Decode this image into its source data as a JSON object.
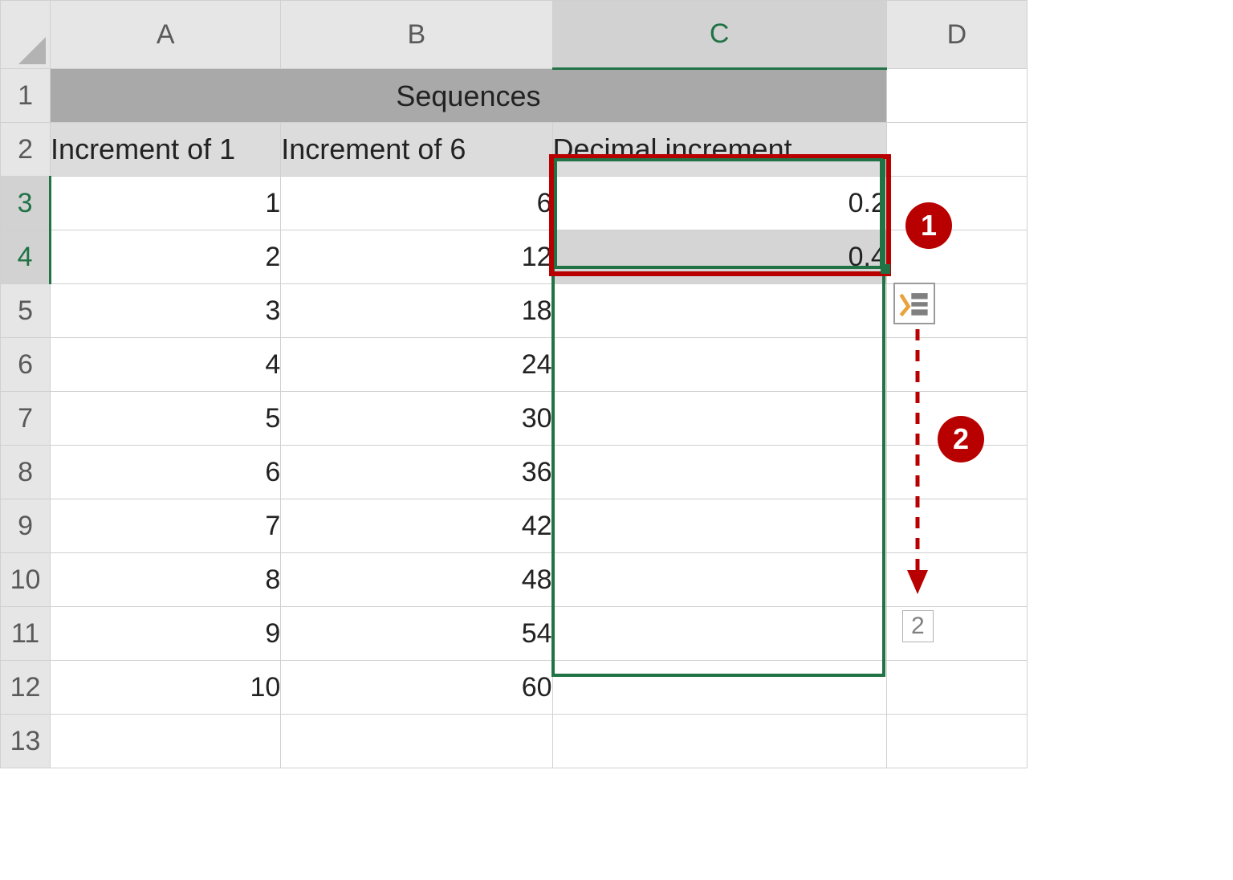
{
  "columns": [
    "A",
    "B",
    "C",
    "D"
  ],
  "rows": [
    "1",
    "2",
    "3",
    "4",
    "5",
    "6",
    "7",
    "8",
    "9",
    "10",
    "11",
    "12",
    "13"
  ],
  "title": "Sequences",
  "headers": {
    "A": "Increment of 1",
    "B": "Increment of 6",
    "C": "Decimal increment"
  },
  "cells": {
    "A3": "1",
    "B3": "6",
    "C3": "0.2",
    "A4": "2",
    "B4": "12",
    "C4": "0.4",
    "A5": "3",
    "B5": "18",
    "A6": "4",
    "B6": "24",
    "A7": "5",
    "B7": "30",
    "A8": "6",
    "B8": "36",
    "A9": "7",
    "B9": "42",
    "A10": "8",
    "B10": "48",
    "A11": "9",
    "B11": "54",
    "A12": "10",
    "B12": "60"
  },
  "callouts": {
    "one": "1",
    "two": "2"
  },
  "drag_hint": "2",
  "active_column": "C",
  "active_rows": [
    "3",
    "4"
  ],
  "selection": "C3:C4",
  "fill_range": "C3:C12"
}
